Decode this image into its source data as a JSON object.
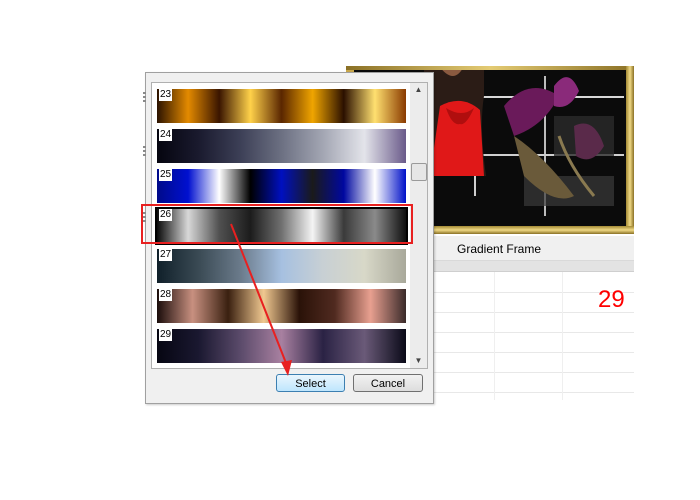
{
  "dialog": {
    "title_fragment": "Gradient",
    "buttons": {
      "select": "Select",
      "cancel": "Cancel"
    },
    "scroll": {
      "up": "▲",
      "down": "▼"
    },
    "gradients": [
      {
        "number": "23",
        "stops": [
          "#2b1200",
          "#e38a00",
          "#3a1500",
          "#ffd14a",
          "#5a2600",
          "#f0a500",
          "#2b1000",
          "#ffe070",
          "#8a3a00"
        ]
      },
      {
        "number": "24",
        "stops": [
          "#05050f",
          "#1a1a2e",
          "#3c3f56",
          "#6c7082",
          "#a3a6b3",
          "#e3e4ea",
          "#6a5a8a"
        ]
      },
      {
        "number": "25",
        "stops": [
          "#000a8a",
          "#0010d0",
          "#ffffff",
          "#000000",
          "#0010c0",
          "#1a1a1a",
          "#0008a0",
          "#ffffff",
          "#0010c8"
        ]
      },
      {
        "number": "26",
        "stops": [
          "#0a0a0a",
          "#d8d8d8",
          "#505050",
          "#1c1c1c",
          "#707070",
          "#f4f4f4",
          "#3a3a3a",
          "#8a8a8a",
          "#0e0e0e"
        ]
      },
      {
        "number": "27",
        "stops": [
          "#10202a",
          "#3a4a54",
          "#6a7a8a",
          "#a6c0e0",
          "#c8d0d4",
          "#d8d8c8",
          "#a8a89a"
        ]
      },
      {
        "number": "28",
        "stops": [
          "#1a0c0a",
          "#c89080",
          "#3a2010",
          "#f0c890",
          "#2a1208",
          "#502a20",
          "#e8a090",
          "#3a2a2a"
        ]
      },
      {
        "number": "29",
        "stops": [
          "#060612",
          "#1a1830",
          "#5a4a6a",
          "#a880a0",
          "#2a2244",
          "#6a5a78",
          "#0a0a18"
        ]
      }
    ]
  },
  "panel": {
    "header_label": "Gradient Frame"
  },
  "step_number": "29",
  "colors": {
    "highlight": "#e82020",
    "accent": "#3c7fb1",
    "frame": "#c9a84b"
  }
}
